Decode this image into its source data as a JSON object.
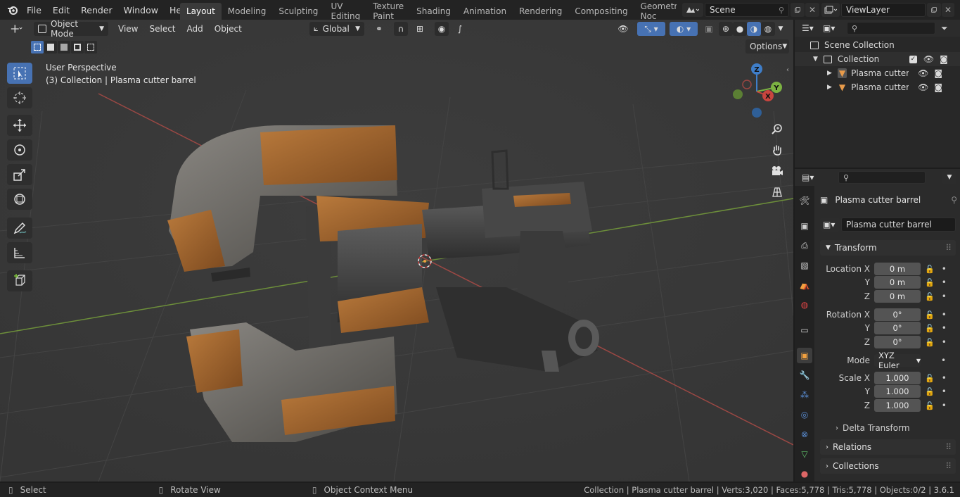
{
  "topbar": {
    "menus": [
      "File",
      "Edit",
      "Render",
      "Window",
      "Help"
    ],
    "workspaces": [
      "Layout",
      "Modeling",
      "Sculpting",
      "UV Editing",
      "Texture Paint",
      "Shading",
      "Animation",
      "Rendering",
      "Compositing",
      "Geometry Noc"
    ],
    "active_workspace": "Layout",
    "scene": "Scene",
    "view_layer": "ViewLayer"
  },
  "viewport": {
    "mode": "Object Mode",
    "menus": [
      "View",
      "Select",
      "Add",
      "Object"
    ],
    "orientation": "Global",
    "options_label": "Options",
    "overlay_title": "User Perspective",
    "overlay_subtitle": "(3) Collection | Plasma cutter barrel",
    "gizmo": {
      "x": "X",
      "y": "Y",
      "z": "Z"
    }
  },
  "outliner": {
    "root": "Scene Collection",
    "collection": "Collection",
    "objects": [
      "Plasma cutter ba",
      "Plasma cutter m"
    ]
  },
  "properties": {
    "object_name": "Plasma cutter barrel",
    "data_name": "Plasma cutter barrel",
    "transform_label": "Transform",
    "location": {
      "label_x": "Location X",
      "x": "0 m",
      "y": "0 m",
      "z": "0 m"
    },
    "rotation": {
      "label_x": "Rotation X",
      "x": "0°",
      "y": "0°",
      "z": "0°"
    },
    "mode_label": "Mode",
    "mode_value": "XYZ Euler",
    "scale": {
      "label_x": "Scale X",
      "x": "1.000",
      "y": "1.000",
      "z": "1.000"
    },
    "axis_y": "Y",
    "axis_z": "Z",
    "delta_transform": "Delta Transform",
    "relations": "Relations",
    "collections": "Collections"
  },
  "statusbar": {
    "select": "Select",
    "rotate": "Rotate View",
    "context": "Object Context Menu",
    "stats": "Collection | Plasma cutter barrel | Verts:3,020 | Faces:5,778 | Tris:5,778 | Objects:0/2 | 3.6.1"
  },
  "colors": {
    "accent": "#4772b3",
    "x_axis": "#c9453f",
    "y_axis": "#7cb342",
    "z_axis": "#3f7ec9",
    "copper": "#a8692e"
  }
}
